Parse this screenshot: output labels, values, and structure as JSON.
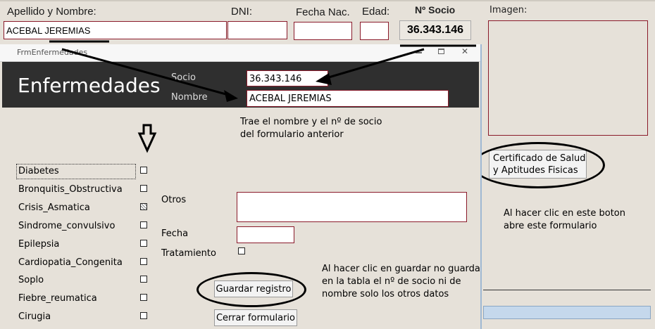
{
  "bg_form": {
    "apellido_label": "Apellido y Nombre:",
    "apellido_value": "ACEBAL JEREMIAS",
    "dni_label": "DNI:",
    "fecha_nac_label": "Fecha Nac.",
    "edad_label": "Edad:",
    "nro_socio_label": "Nº Socio",
    "nro_socio_value": "36.343.146",
    "imagen_label": "Imagen:",
    "cert_button": "Certificado de Salud\ny Aptitudes Fisicas",
    "note_cert": "Al hacer clic en este boton\nabre este formulario"
  },
  "dialog": {
    "title": "FrmEnfermedades",
    "header": "Enfermedades",
    "socio_label": "Socio",
    "socio_value": "36.343.146",
    "nombre_label": "Nombre",
    "nombre_value": "ACEBAL JEREMIAS",
    "note_top": "Trae el nombre y el nº de socio\ndel formulario anterior",
    "diseases": [
      {
        "label": "Diabetes",
        "checked": false
      },
      {
        "label": "Bronquitis_Obstructiva",
        "checked": false
      },
      {
        "label": "Crisis_Asmatica",
        "checked": true
      },
      {
        "label": "Sindrome_convulsivo",
        "checked": false
      },
      {
        "label": "Epilepsia",
        "checked": false
      },
      {
        "label": "Cardiopatia_Congenita",
        "checked": false
      },
      {
        "label": "Soplo",
        "checked": false
      },
      {
        "label": "Fiebre_reumatica",
        "checked": false
      },
      {
        "label": "Cirugia",
        "checked": false
      }
    ],
    "otros_label": "Otros",
    "fecha_label": "Fecha",
    "tratamiento_label": "Tratamiento",
    "guardar_button": "Guardar registro",
    "cerrar_button": "Cerrar formulario",
    "note_guardar": "Al hacer clic en guardar no guarda\nen la tabla el nº de socio ni de\nnombre solo los otros datos"
  },
  "colors": {
    "header_bg": "#2f2f2f",
    "field_border": "#8a1a2a",
    "form_bg": "#e6e1d9"
  }
}
